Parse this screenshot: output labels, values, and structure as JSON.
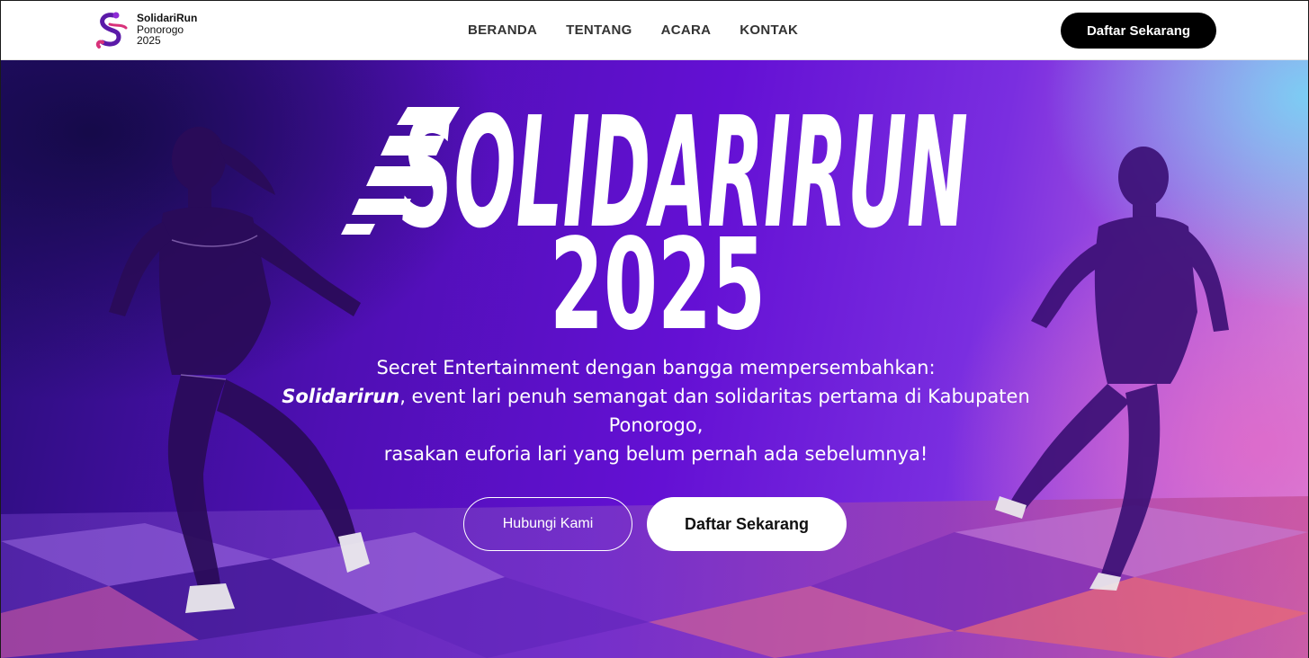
{
  "header": {
    "logo": {
      "line1": "SolidariRun",
      "line2": "Ponorogo",
      "line3": "2025"
    },
    "nav": [
      {
        "label": "BERANDA"
      },
      {
        "label": "TENTANG"
      },
      {
        "label": "ACARA"
      },
      {
        "label": "KONTAK"
      }
    ],
    "cta_label": "Daftar Sekarang"
  },
  "hero": {
    "title": "SOLIDARIRUN",
    "year": "2025",
    "tagline": {
      "line1": "Secret Entertainment dengan bangga mempersembahkan:",
      "brand": "Solidarirun",
      "line2_rest": ", event lari penuh semangat dan solidaritas pertama di Kabupaten Ponorogo,",
      "line3": "rasakan euforia lari yang belum pernah ada sebelumnya!"
    },
    "buttons": {
      "contact": "Hubungi Kami",
      "register": "Daftar Sekarang"
    }
  },
  "colors": {
    "hero_purple": "#6410d4",
    "hero_cyan": "#78d2f5",
    "hero_pink": "#e169c8",
    "cta_black": "#000000",
    "logo_purple": "#5b1aa8",
    "logo_pink": "#d8327a"
  },
  "icons": {
    "logo_mark": "s-runner-logo-icon"
  }
}
